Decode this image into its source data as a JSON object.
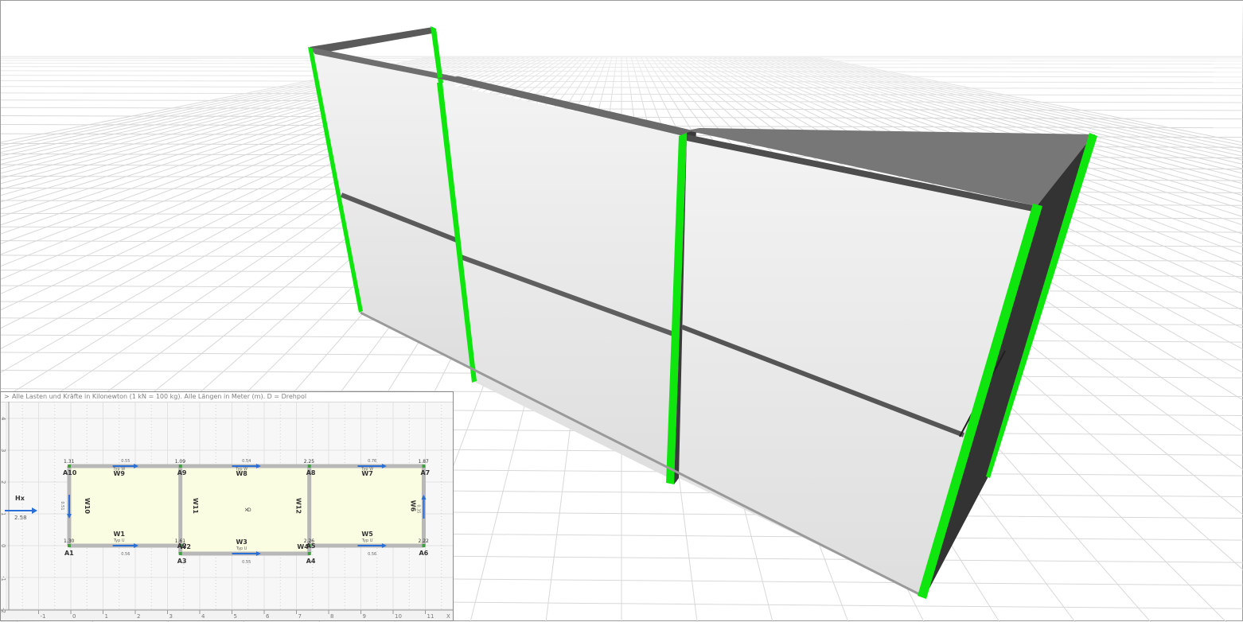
{
  "viewport": {
    "name": "3D wall model view",
    "colors": {
      "panel_fill": "#ebebeb",
      "frame_edge": "#0ee60e",
      "top_rail": "#5a5a5a",
      "end_wall": "#333333",
      "grid_line": "#d8d8d8"
    }
  },
  "plan_panel": {
    "info_text": "Alle Lasten und Kräfte in Kilonewton (1 kN = 100 kg). Alle Längen in Meter (m). D = Drehpol",
    "load_label": "Hx",
    "load_value": "2.58",
    "x_axis_ticks": [
      "-1",
      "0",
      "1",
      "2",
      "3",
      "4",
      "5",
      "6",
      "7",
      "8",
      "9",
      "10",
      "11"
    ],
    "x_axis_label": "X",
    "y_axis_ticks": [
      "4",
      "3",
      "2",
      "1",
      "0",
      "-1",
      "-2"
    ],
    "anchors": [
      "A10",
      "A9",
      "A8",
      "A7",
      "A1",
      "A2",
      "A3",
      "A4",
      "A5",
      "A6"
    ],
    "anchor_values": {
      "A10": "1.31",
      "A9": "1.09",
      "A8": "2.25",
      "A7": "1.87",
      "A1": "1.30",
      "A2": "1.61",
      "A5": "2.26",
      "A6": "2.22"
    },
    "walls": {
      "W9": "W9",
      "W8": "W8",
      "W7": "W7",
      "W1": "W1",
      "W3": "W3",
      "W5": "W5",
      "W10": "W10",
      "W11": "W11",
      "W12": "W12",
      "W6": "W6",
      "W2": "W2",
      "W4": "W4"
    },
    "wall_types": {
      "top": "Typ W",
      "bottom": "Typ U"
    },
    "arrow_values": {
      "W9": "0.55",
      "W8": "0.54",
      "W7": "0.76",
      "W1": "0.56",
      "W3": "0.55",
      "W5": "0.56",
      "W10": "0.51",
      "W6": "0.35"
    },
    "center_marker": "D",
    "colors": {
      "room_fill": "#fbfde2",
      "wall": "#b8b8b8",
      "arrow": "#2a6fd6",
      "node": "#3fa03f"
    }
  }
}
